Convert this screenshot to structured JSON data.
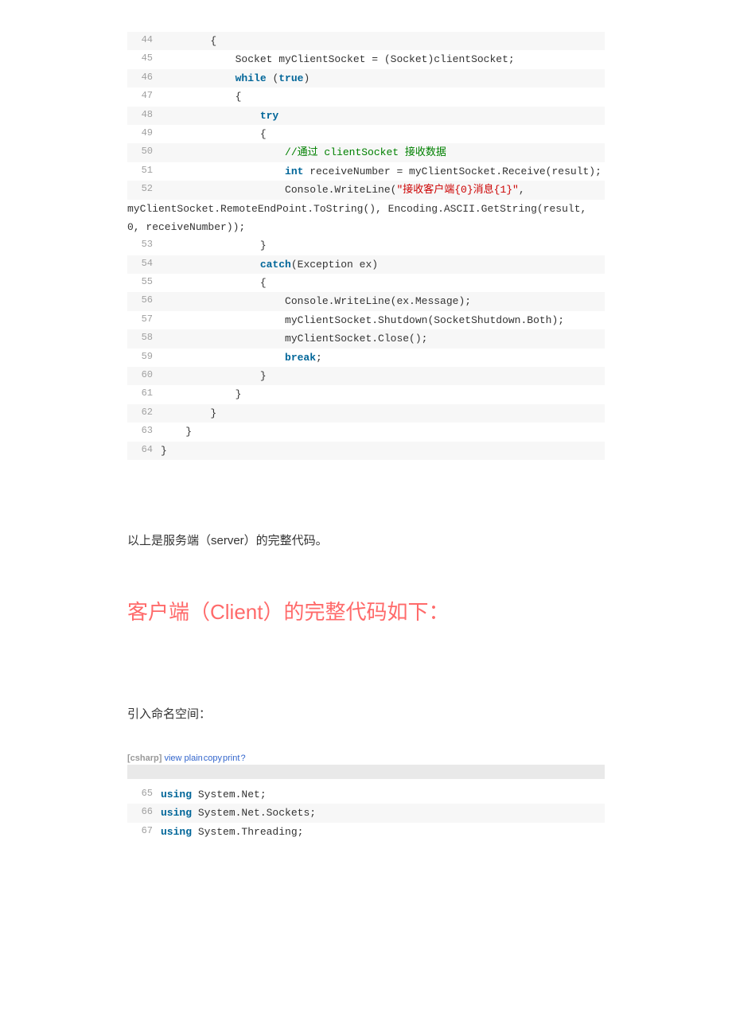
{
  "code1": {
    "lines": [
      {
        "n": 44,
        "html": "        {"
      },
      {
        "n": 45,
        "html": "            Socket myClientSocket = (Socket)clientSocket;"
      },
      {
        "n": 46,
        "html": "            <span class=\"kw2\">while</span> (<span class=\"kw2\">true</span>)"
      },
      {
        "n": 47,
        "html": "            {"
      },
      {
        "n": 48,
        "html": "                <span class=\"kw2\">try</span>"
      },
      {
        "n": 49,
        "html": "                {"
      },
      {
        "n": 50,
        "html": "                    <span class=\"comment\">//通过 clientSocket 接收数据</span>"
      },
      {
        "n": 51,
        "html": "                    <span class=\"kw2\">int</span> receiveNumber = myClientSocket.Receive(result);"
      },
      {
        "n": 52,
        "html": "                    Console.WriteLine(<span class=\"str\">\"接收客户端{0}消息{1}\"</span>,"
      }
    ],
    "continuation": "myClientSocket.RemoteEndPoint.ToString(), Encoding.ASCII.GetString(result, 0, receiveNumber));",
    "lines2": [
      {
        "n": 53,
        "html": "                }"
      },
      {
        "n": 54,
        "html": "                <span class=\"kw2\">catch</span>(Exception ex)"
      },
      {
        "n": 55,
        "html": "                {"
      },
      {
        "n": 56,
        "html": "                    Console.WriteLine(ex.Message);"
      },
      {
        "n": 57,
        "html": "                    myClientSocket.Shutdown(SocketShutdown.Both);"
      },
      {
        "n": 58,
        "html": "                    myClientSocket.Close();"
      },
      {
        "n": 59,
        "html": "                    <span class=\"kw2\">break</span>;"
      },
      {
        "n": 60,
        "html": "                }"
      },
      {
        "n": 61,
        "html": "            }"
      },
      {
        "n": 62,
        "html": "        }"
      },
      {
        "n": 63,
        "html": "    }"
      },
      {
        "n": 64,
        "html": "}"
      }
    ]
  },
  "para1": "以上是服务端（server）的完整代码。",
  "heading": "客户端（Client）的完整代码如下：",
  "para2": "引入命名空间：",
  "codeHeader": {
    "lang": "[csharp]",
    "links": [
      "view plain",
      "copy",
      "print",
      "?"
    ]
  },
  "code2": {
    "lines": [
      {
        "n": 65,
        "html": "<span class=\"kw2\">using</span> System.Net;"
      },
      {
        "n": 66,
        "html": "<span class=\"kw2\">using</span> System.Net.Sockets;"
      },
      {
        "n": 67,
        "html": "<span class=\"kw2\">using</span> System.Threading;"
      }
    ]
  }
}
